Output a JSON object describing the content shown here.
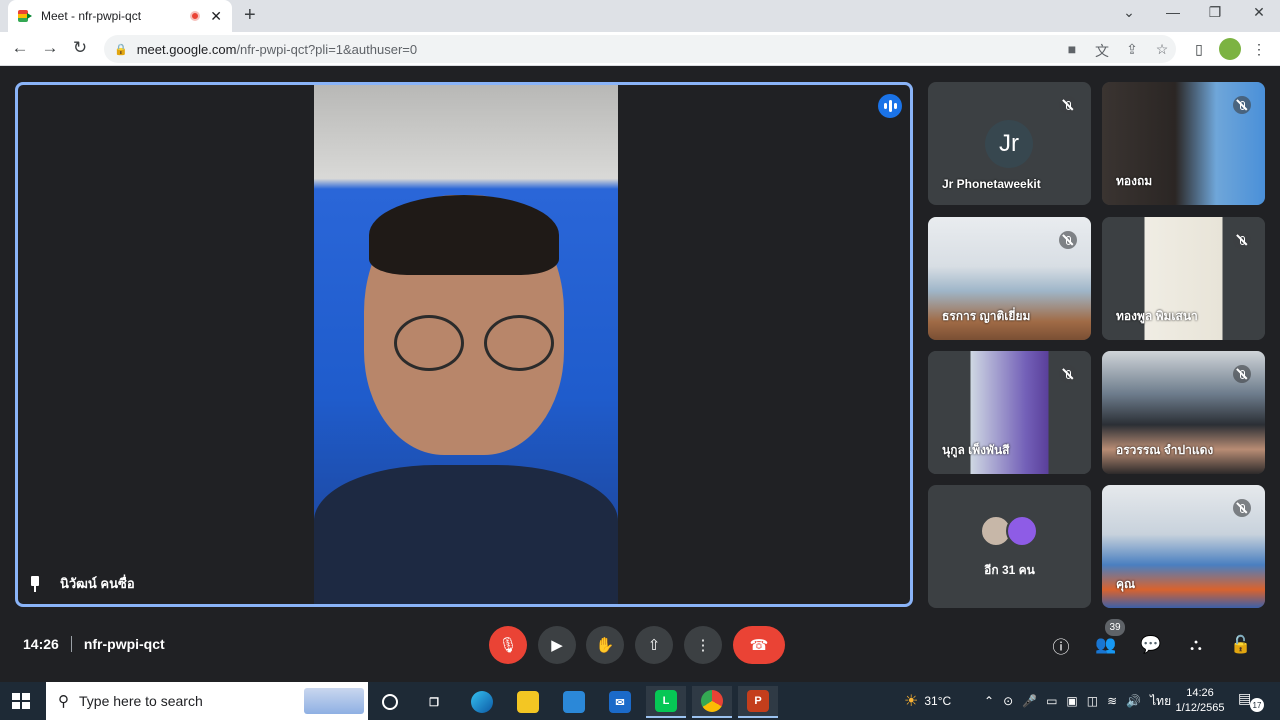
{
  "browser": {
    "tab_title": "Meet - nfr-pwpi-qct",
    "tab_close": "✕",
    "new_tab": "+",
    "url_host": "meet.google.com",
    "url_path": "/nfr-pwpi-qct?pli=1&authuser=0",
    "controls": {
      "minimize": "—",
      "maximize": "❐",
      "close": "✕",
      "dropdown": "⌄"
    },
    "nav": {
      "back": "←",
      "forward": "→",
      "reload": "↻"
    },
    "omni_icons": [
      "camera-icon",
      "translate-icon",
      "share-icon",
      "star-icon"
    ],
    "extras": {
      "sidepanel": "▯",
      "menu": "⋮"
    }
  },
  "meet": {
    "main_speaker": {
      "name": "นิวัฒน์ คนซื่อ"
    },
    "tiles": [
      {
        "name": "Jr Phonetaweekit",
        "initials": "Jr",
        "type": "avatar"
      },
      {
        "name": "ทองถม",
        "type": "video"
      },
      {
        "name": "ธรการ ญาติเยี่ยม",
        "type": "video"
      },
      {
        "name": "ทองพูล พิมเสนา",
        "type": "video"
      },
      {
        "name": "นุกูล เพ็งพันสี",
        "type": "video"
      },
      {
        "name": "อรวรรณ จำปาแดง",
        "type": "video"
      },
      {
        "name": "อีก 31 คน",
        "type": "more"
      },
      {
        "name": "คุณ",
        "type": "video"
      }
    ],
    "bottom": {
      "time": "14:26",
      "meeting_code": "nfr-pwpi-qct",
      "participants_count": "39"
    },
    "colors": {
      "accent": "#8ab4f8",
      "end_call": "#ea4335",
      "background": "#202124"
    }
  },
  "taskbar": {
    "search_placeholder": "Type here to search",
    "weather": "31°C",
    "language": "ไทย",
    "clock_time": "14:26",
    "clock_date": "1/12/2565",
    "notification_count": "17",
    "apps": [
      "task-view-icon",
      "edge-icon",
      "file-explorer-icon",
      "store-icon",
      "mail-icon",
      "line-icon",
      "chrome-icon",
      "powerpoint-icon"
    ]
  }
}
